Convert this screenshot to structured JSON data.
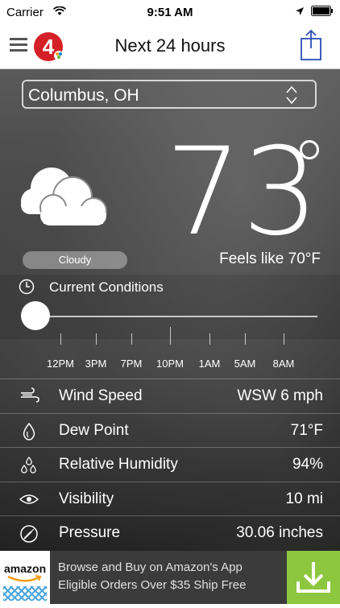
{
  "status_bar": {
    "carrier": "Carrier",
    "time": "9:51 AM"
  },
  "nav": {
    "title": "Next 24 hours"
  },
  "location": {
    "value": "Columbus, OH"
  },
  "current": {
    "temperature": "73",
    "condition": "Cloudy",
    "feels_like": "Feels like 70°F"
  },
  "timeline": {
    "label": "Current Conditions",
    "ticks": [
      "12PM",
      "3PM",
      "7PM",
      "10PM",
      "1AM",
      "5AM",
      "8AM"
    ],
    "position": 0
  },
  "details": [
    {
      "icon": "wind-icon",
      "label": "Wind Speed",
      "value": "WSW 6 mph"
    },
    {
      "icon": "dew-drop-icon",
      "label": "Dew Point",
      "value": "71°F"
    },
    {
      "icon": "humidity-drops-icon",
      "label": "Relative Humidity",
      "value": "94%"
    },
    {
      "icon": "eye-icon",
      "label": "Visibility",
      "value": "10 mi"
    },
    {
      "icon": "pressure-gauge-icon",
      "label": "Pressure",
      "value": "30.06 inches"
    }
  ],
  "ad": {
    "brand": "amazon",
    "line1": "Browse and Buy on Amazon's App",
    "line2": "Eligible Orders Over $35 Ship Free"
  }
}
